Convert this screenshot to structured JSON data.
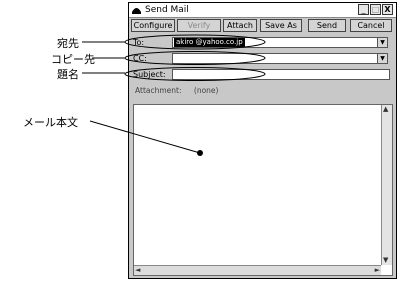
{
  "annotations": {
    "recipient": "宛先",
    "cc": "コピー先",
    "subject": "題名",
    "body": "メール本文"
  },
  "window": {
    "title": "Send Mail",
    "controls": [
      "_",
      "□",
      "X"
    ]
  },
  "toolbar": {
    "configure": "Configure",
    "verify": "Verify",
    "attach": "Attach",
    "save_as": "Save As",
    "send": "Send",
    "cancel": "Cancel"
  },
  "fields": {
    "to_label": "To:",
    "to_value": "akiro    @yahoo.co.jp",
    "cc_label": "CC:",
    "cc_value": "",
    "subject_label": "Subject:",
    "subject_value": ""
  },
  "attachment": {
    "label": "Attachment:",
    "value": "(none)"
  }
}
